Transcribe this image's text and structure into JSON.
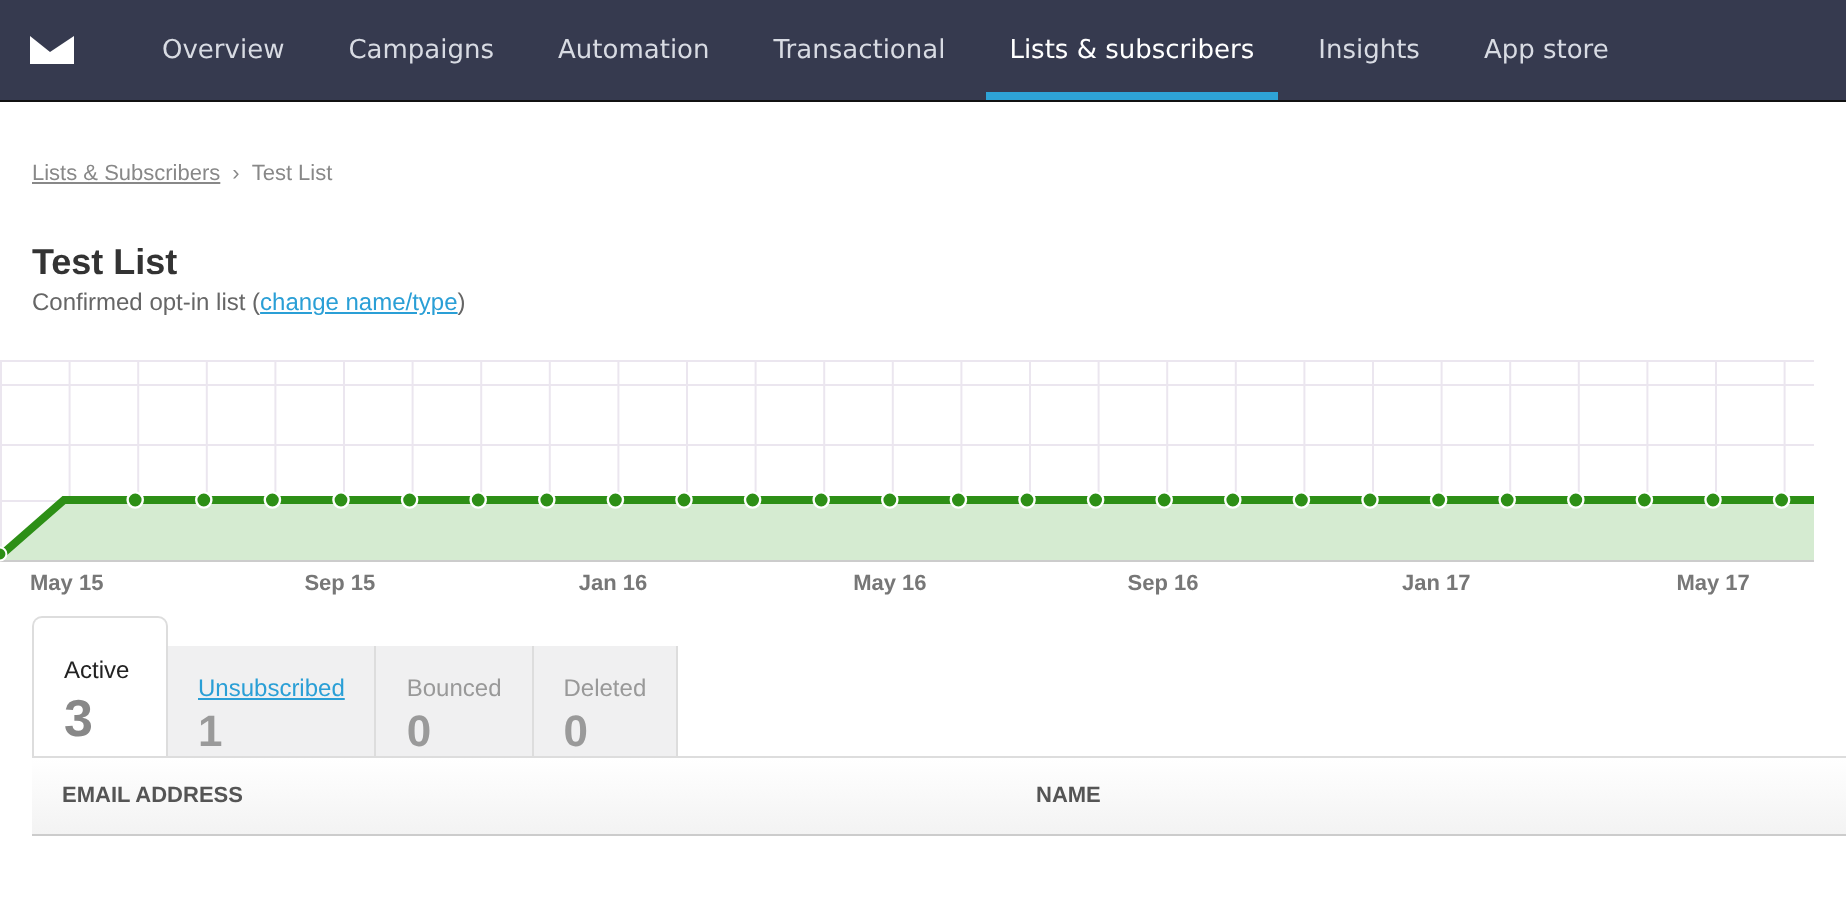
{
  "nav": {
    "items": [
      {
        "label": "Overview",
        "selected": false
      },
      {
        "label": "Campaigns",
        "selected": false
      },
      {
        "label": "Automation",
        "selected": false
      },
      {
        "label": "Transactional",
        "selected": false
      },
      {
        "label": "Lists & subscribers",
        "selected": true
      },
      {
        "label": "Insights",
        "selected": false
      },
      {
        "label": "App store",
        "selected": false
      }
    ]
  },
  "breadcrumb": {
    "link": "Lists & Subscribers",
    "separator": "›",
    "current": "Test List"
  },
  "title": "Test List",
  "subtitle": {
    "text": "Confirmed opt-in list (",
    "link": "change name/type",
    "end": ")"
  },
  "chart": {
    "x_labels": [
      "May 15",
      "Sep 15",
      "Jan 16",
      "May 16",
      "Sep 16",
      "Jan 17",
      "May 17"
    ]
  },
  "tabs": [
    {
      "label": "Active",
      "count": "3",
      "selected": true,
      "kind": "plain"
    },
    {
      "label": "Unsubscribed",
      "count": "1",
      "selected": false,
      "kind": "link"
    },
    {
      "label": "Bounced",
      "count": "0",
      "selected": false,
      "kind": "plain"
    },
    {
      "label": "Deleted",
      "count": "0",
      "selected": false,
      "kind": "plain"
    }
  ],
  "table": {
    "columns": [
      "EMAIL ADDRESS",
      "NAME"
    ]
  }
}
